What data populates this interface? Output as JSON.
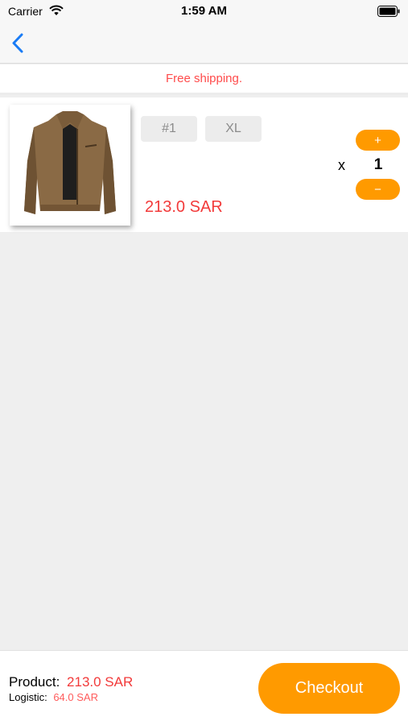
{
  "status_bar": {
    "carrier": "Carrier",
    "time": "1:59 AM",
    "icons": [
      "wifi-icon",
      "battery-icon"
    ]
  },
  "nav": {
    "back_icon": "chevron-left-icon",
    "accent_color": "#1a7cf5"
  },
  "banner": {
    "text": "Free shipping.",
    "color": "#ff4b4b"
  },
  "cart": {
    "items": [
      {
        "image": "brown zip jacket product photo",
        "variant_number": "#1",
        "size": "XL",
        "price": "213.0 SAR",
        "qty_prefix": "x",
        "quantity": "1",
        "plus_label": "+",
        "minus_label": "−"
      }
    ]
  },
  "footer": {
    "product_label": "Product:",
    "product_total": "213.0 SAR",
    "logistic_label": "Logistic:",
    "logistic_total": "64.0 SAR",
    "checkout_label": "Checkout",
    "accent_color": "#ff9a00",
    "price_color": "#f23a3a"
  }
}
